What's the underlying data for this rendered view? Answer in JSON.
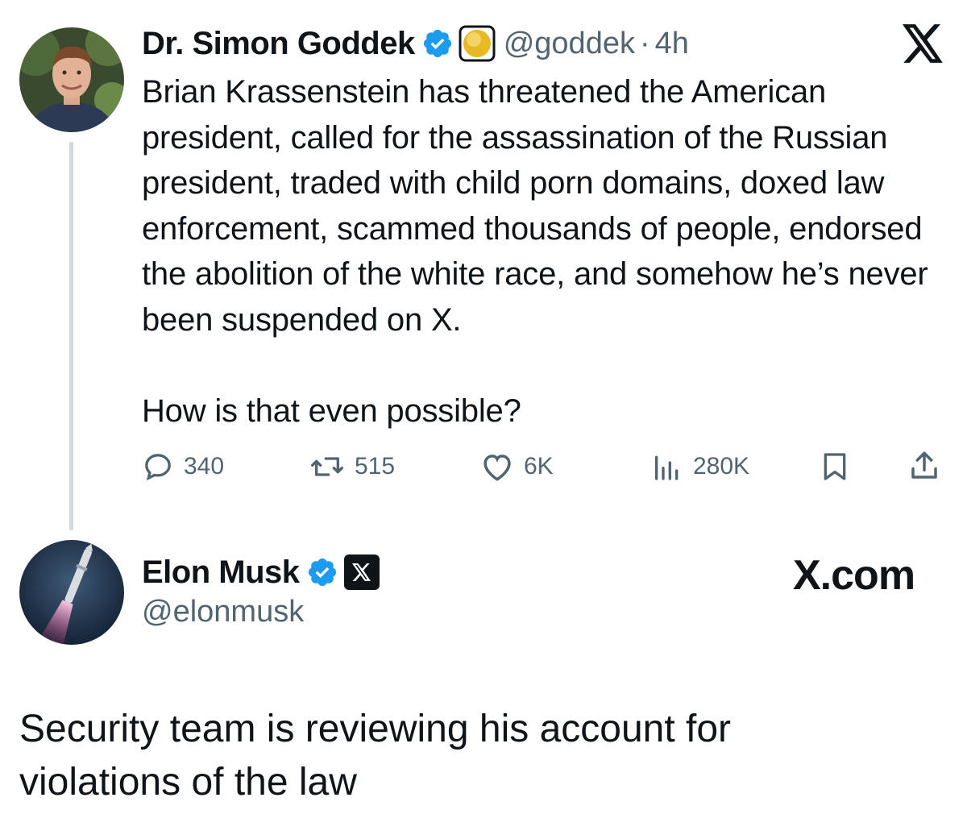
{
  "original_tweet": {
    "display_name": "Dr. Simon Goddek",
    "handle": "@goddek",
    "separator": "·",
    "time": "4h",
    "text": "Brian Krassenstein has threatened the American president, called for the assassination of the Russian president, traded with child porn domains, doxed law enforcement, scammed thousands of people, endorsed the abolition of the white race, and somehow he’s never been suspended on X.\n\nHow is that even possible?",
    "replies": "340",
    "reposts": "515",
    "likes": "6K",
    "views": "280K",
    "platform_icon": "x-logo-icon"
  },
  "reply_tweet": {
    "display_name": "Elon Musk",
    "handle": "@elonmusk",
    "affiliation_label": "X.com",
    "text": "Security team is reviewing his account for\nviolations of the law"
  },
  "colors": {
    "verified_blue": "#1d9bf0",
    "secondary_text": "#536471",
    "thread_line": "#cfd9de"
  }
}
